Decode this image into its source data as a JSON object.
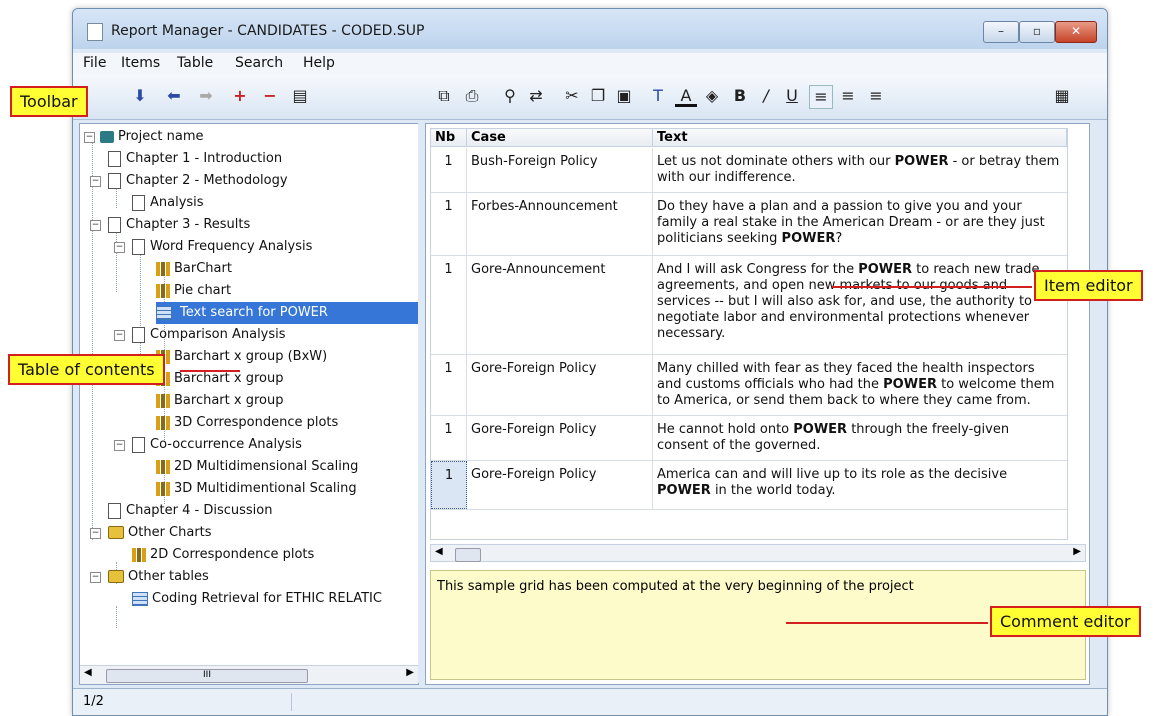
{
  "window": {
    "title": "Report Manager - CANDIDATES - CODED.SUP",
    "controls": [
      "–",
      "▫",
      "✕"
    ]
  },
  "menu": [
    {
      "label": "File"
    },
    {
      "label": "Items"
    },
    {
      "label": "Table"
    },
    {
      "label": "Search"
    },
    {
      "label": "Help"
    }
  ],
  "toolbar": {
    "left_icons": [
      "arrow-down-icon",
      "arrow-left-icon",
      "arrow-right-icon",
      "plus-icon",
      "minus-icon",
      "export-icon"
    ],
    "right_icons": [
      "copy-icon",
      "print-icon",
      "find-icon",
      "replace-icon",
      "cut-icon",
      "copy-doc-icon",
      "paste-icon",
      "font-icon",
      "font-color-icon",
      "highlight-icon",
      "bold-icon",
      "italic-icon",
      "underline-icon",
      "align-left-icon",
      "align-center-icon",
      "align-right-icon",
      "table-settings-icon"
    ],
    "bold_glyph": "B",
    "italic_glyph": "/",
    "underline_glyph": "U"
  },
  "tree": {
    "items": [
      {
        "label": "Project name"
      },
      {
        "label": "Chapter 1 - Introduction"
      },
      {
        "label": "Chapter 2 - Methodology"
      },
      {
        "label": "Analysis"
      },
      {
        "label": "Chapter 3 - Results"
      },
      {
        "label": "Word Frequency Analysis"
      },
      {
        "label": "BarChart"
      },
      {
        "label": "Pie chart"
      },
      {
        "label": "Text search for POWER"
      },
      {
        "label": "Comparison Analysis"
      },
      {
        "label": "Barchart x group (BxW)"
      },
      {
        "label": "Barchart x group"
      },
      {
        "label": "Barchart x group"
      },
      {
        "label": "3D Correspondence plots"
      },
      {
        "label": "Co-occurrence Analysis"
      },
      {
        "label": "2D Multidimensional Scaling"
      },
      {
        "label": "3D Multidimentional Scaling"
      },
      {
        "label": "Chapter 4 - Discussion"
      },
      {
        "label": "Other Charts"
      },
      {
        "label": "2D Correspondence plots"
      },
      {
        "label": "Other tables"
      },
      {
        "label": "Coding Retrieval for ETHIC RELATIC"
      }
    ],
    "hscroll_label": "III"
  },
  "table": {
    "headers": [
      "Nb",
      "Case",
      "Text"
    ],
    "rows": [
      {
        "nb": "1",
        "case": "Bush-Foreign Policy",
        "pre": "Let us not dominate others with our ",
        "keyword": "POWER",
        "post": " - or betray them with our indifference."
      },
      {
        "nb": "1",
        "case": "Forbes-Announcement",
        "pre": "Do they have a plan and a passion to give you and your family a real stake in the American Dream - or are they just politicians seeking ",
        "keyword": "POWER",
        "post": "?"
      },
      {
        "nb": "1",
        "case": "Gore-Announcement",
        "pre": "And I will ask Congress for the ",
        "keyword": "POWER",
        "post": " to reach new trade agreements, and open new markets to our goods and services -- but I will also ask for, and use, the authority to negotiate labor and environmental protections whenever necessary."
      },
      {
        "nb": "1",
        "case": "Gore-Foreign Policy",
        "pre": "Many chilled with fear as they faced the health inspectors and customs officials who had the ",
        "keyword": "POWER",
        "post": " to welcome them to America, or send them back to where they came from."
      },
      {
        "nb": "1",
        "case": "Gore-Foreign Policy",
        "pre": "He cannot hold onto ",
        "keyword": "POWER",
        "post": " through the freely-given consent of the governed."
      },
      {
        "nb": "1",
        "case": "Gore-Foreign Policy",
        "pre": "America can and will live up to its role as the decisive ",
        "keyword": "POWER",
        "post": " in the world today."
      }
    ]
  },
  "comment": {
    "text": "This sample grid has been computed at the very beginning of the project"
  },
  "status": {
    "text": "1/2"
  },
  "callouts": {
    "toolbar": "Toolbar",
    "toc": "Table of contents",
    "item_editor": "Item editor",
    "comment_editor": "Comment editor"
  }
}
